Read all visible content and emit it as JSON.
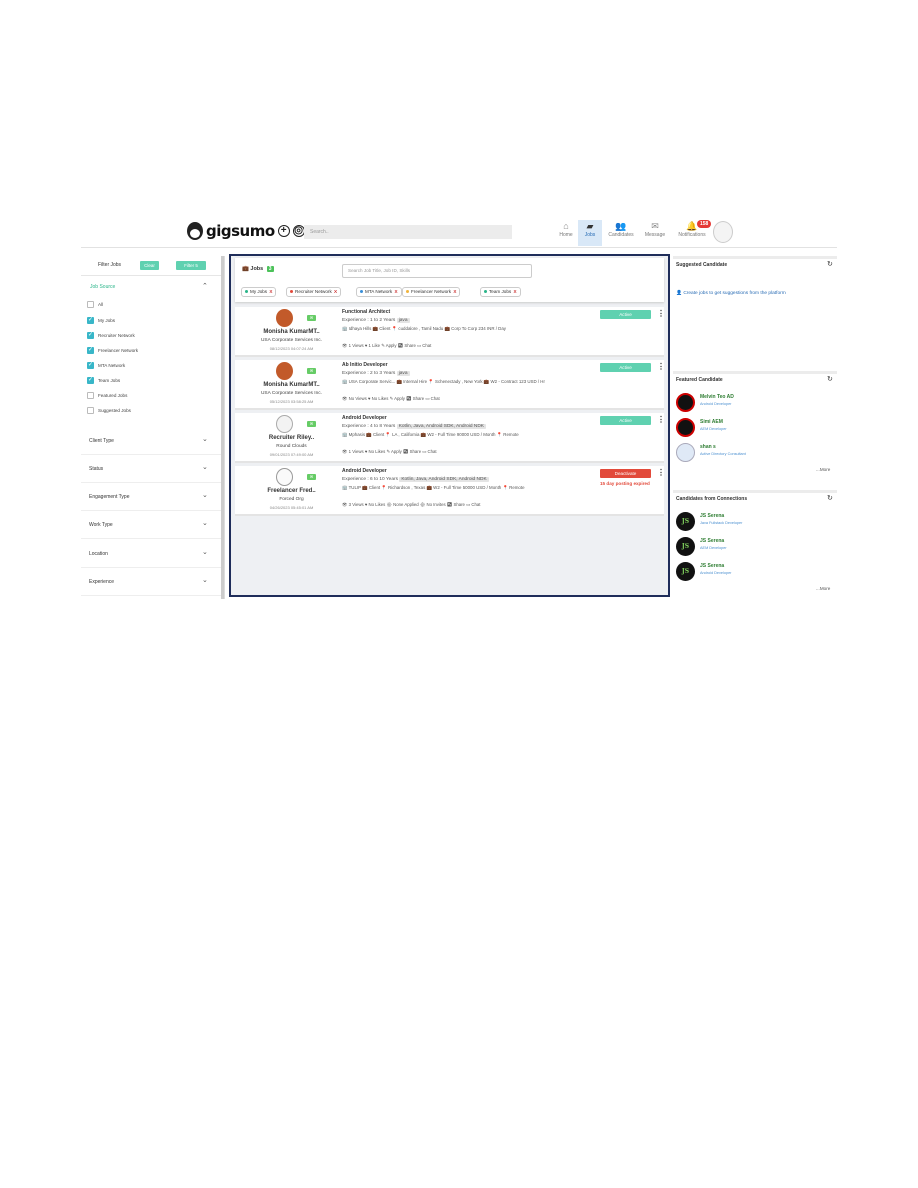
{
  "header": {
    "logo_text": "gigsumo",
    "search_placeholder": "Search..",
    "nav": [
      {
        "label": "Home",
        "icon": "home-icon"
      },
      {
        "label": "Jobs",
        "icon": "briefcase-icon"
      },
      {
        "label": "Candidates",
        "icon": "users-icon"
      },
      {
        "label": "Message",
        "icon": "envelope-icon"
      },
      {
        "label": "Notifications",
        "icon": "bell-icon"
      }
    ],
    "notification_count": "158"
  },
  "sidebar": {
    "title": "Filter Jobs",
    "clear_label": "Clear",
    "filter_label": "Filter 5",
    "job_source_label": "Job Source",
    "job_source_options": [
      {
        "label": "All",
        "checked": false
      },
      {
        "label": "My Jobs",
        "checked": true
      },
      {
        "label": "Recruiter Network",
        "checked": true
      },
      {
        "label": "Freelancer Network",
        "checked": true
      },
      {
        "label": "MTA Network",
        "checked": true
      },
      {
        "label": "Team Jobs",
        "checked": true
      },
      {
        "label": "Featured Jobs",
        "checked": false
      },
      {
        "label": "Suggested Jobs",
        "checked": false
      }
    ],
    "sections": [
      "Client Type",
      "Status",
      "Engagement Type",
      "Work Type",
      "Location",
      "Experience"
    ]
  },
  "main": {
    "jobs_label": "Jobs",
    "jobs_count": "3",
    "search_placeholder": "Search Job Title, Job ID, Skills",
    "chips": [
      {
        "label": "My Jobs",
        "color": "#2bb58a"
      },
      {
        "label": "Recruiter Network",
        "color": "#e24a3b"
      },
      {
        "label": "MTA Network",
        "color": "#3a8fd8"
      },
      {
        "label": "Freelancer Network",
        "color": "#f0b43c"
      },
      {
        "label": "Team Jobs",
        "color": "#2bb58a"
      }
    ],
    "chip_remove": "X",
    "cards": [
      {
        "name": "Monisha KumarMT..",
        "company": "USA Corporate Services Inc.",
        "date": "08/12/2023 04:07:24 AM",
        "title": "Functional Architect",
        "experience": "Experience : 1 to 2 Years",
        "skills": "java",
        "meta": "🏢 Idhaya Hills   💼 Client   📍 cuddalore , Tamil Nadu   💼 Corp To Corp   234 INR / Day",
        "actions": "👁 1 Views   ♥ 1 Like   ✎ Apply   ↪ Share   ▭ Chat",
        "status": "Active",
        "expired": ""
      },
      {
        "name": "Monisha KumarMT..",
        "company": "USA Corporate Services Inc.",
        "date": "05/12/2023 03:58:25 AM",
        "title": "Ab Initio Developer",
        "experience": "Experience : 2 to 3 Years",
        "skills": "java",
        "meta": "🏢 USA Corporate Servic...   💼 Internal Hire   📍 Schenectady , New York   💼 W2 - Contract   123 USD / Hr",
        "actions": "👁 No Views   ♥ No Likes   ✎ Apply   ↪ Share   ▭ Chat",
        "status": "Active",
        "expired": ""
      },
      {
        "name": "Recruiter Riley..",
        "company": "Round Clouds",
        "date": "09/01/2023 07:49:00 AM",
        "title": "Android Developer",
        "experience": "Experience : 4 to 8 Years",
        "skills": "Kotlin, Java, Android SDK, Android NDK",
        "meta": "🏢 Mphasis   💼 Client   📍 LA , California   💼 W2 - Full Time   90000 USD / Month   📍 Remote",
        "actions": "👁 1 Views   ♥ No Likes   ✎ Apply   ↪ Share   ▭ Chat",
        "status": "Active",
        "expired": ""
      },
      {
        "name": "Freelancer Fred..",
        "company": "Forced Org",
        "date": "04/26/2023 05:45:01 AM",
        "title": "Android Developer",
        "experience": "Experience : 6 to 10 Years",
        "skills": "Kotlin, Java, Android SDK, Android NDK",
        "meta": "🏢 TULIP   💼 Client   📍 Richardson , Texas   💼 W2 - Full Time   50000 USD / Month   📍 Remote",
        "actions": "👁 3 Views   ♥ No Likes   ⚙ None Applied   ⚙ No Invites   ↪ Share   ▭ Chat",
        "status": "Deactivate",
        "expired": "15 day posting expired"
      }
    ]
  },
  "right": {
    "suggested_title": "Suggested Candidate",
    "suggested_text": "Create jobs to get suggestions from the platform",
    "featured_title": "Featured Candidate",
    "featured": [
      {
        "name": "Melvin Teo AD",
        "role": "Android Developer"
      },
      {
        "name": "Simi AEM",
        "role": "AEM Developer"
      },
      {
        "name": "shan s",
        "role": "Active Directory Consultant"
      }
    ],
    "connections_title": "Candidates from Connections",
    "connections": [
      {
        "name": "JS Serena",
        "role": "Java Fullstack Developer",
        "initials": "JS"
      },
      {
        "name": "JS Serena",
        "role": "AEM Developer",
        "initials": "JS"
      },
      {
        "name": "JS Serena",
        "role": "Android Developer",
        "initials": "JS"
      }
    ],
    "more_label": "...More"
  }
}
